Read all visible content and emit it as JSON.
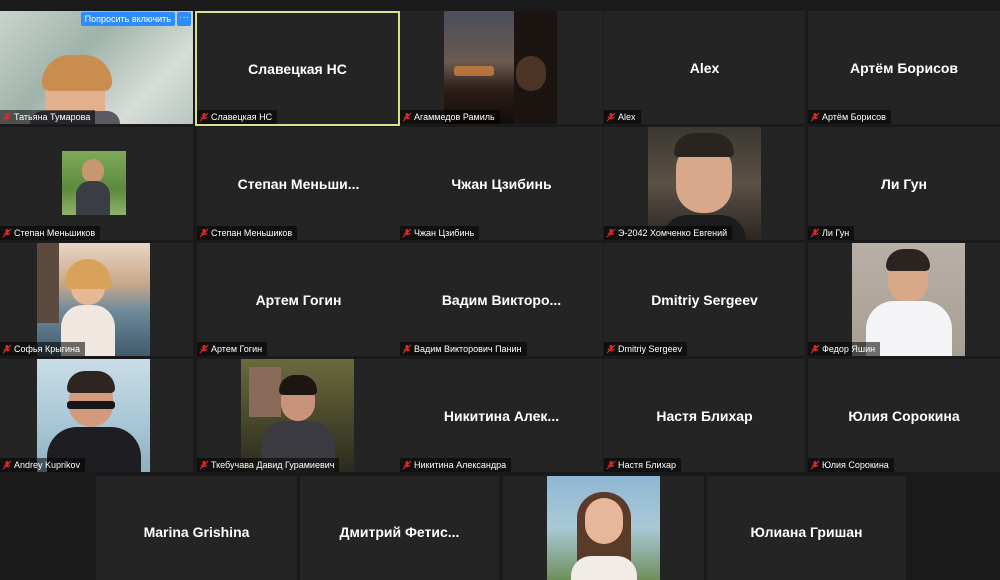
{
  "ask_to_unmute_label": "Попросить включить",
  "more_options_glyph": "···",
  "accent_color": "#2d8cff",
  "active_speaker_border": "#d6e38a",
  "participants": [
    {
      "name": "Татьяна Тумарова",
      "video": true
    },
    {
      "name": "Славецкая НС",
      "display": "Славецкая НС",
      "active": true
    },
    {
      "name": "Агаммедов Рамиль",
      "video": true
    },
    {
      "name": "Alex",
      "display": "Alex"
    },
    {
      "name": "Артём Борисов",
      "display": "Артём Борисов"
    },
    {
      "name": "Степан Меньшиков",
      "video": true
    },
    {
      "name": "Степан Меньшиков",
      "display": "Степан Меньши..."
    },
    {
      "name": "Чжан Цзибинь",
      "display": "Чжан Цзибинь"
    },
    {
      "name": "Э-2042 Хомченко Евгений",
      "video": true
    },
    {
      "name": "Ли Гун",
      "display": "Ли Гун"
    },
    {
      "name": "Софья Крыгина",
      "video": true
    },
    {
      "name": "Артем Гогин",
      "display": "Артем Гогин"
    },
    {
      "name": "Вадим Викторович Панин",
      "display": "Вадим Викторо..."
    },
    {
      "name": "Dmitriy Sergeev",
      "display": "Dmitriy Sergeev"
    },
    {
      "name": "Федор Яшин",
      "video": true
    },
    {
      "name": "Andrey Kuprikov",
      "video": true
    },
    {
      "name": "Ткебучава Давид Гурамиевич",
      "video": true
    },
    {
      "name": "Никитина Александра",
      "display": "Никитина Алек..."
    },
    {
      "name": "Настя Блихар",
      "display": "Настя Блихар"
    },
    {
      "name": "Юлия Сорокина",
      "display": "Юлия Сорокина"
    },
    {
      "name": "",
      "display": "Marina Grishina"
    },
    {
      "name": "",
      "display": "Дмитрий Фетис..."
    },
    {
      "name": "",
      "video": true
    },
    {
      "name": "",
      "display": "Юлиана Гришан"
    }
  ]
}
